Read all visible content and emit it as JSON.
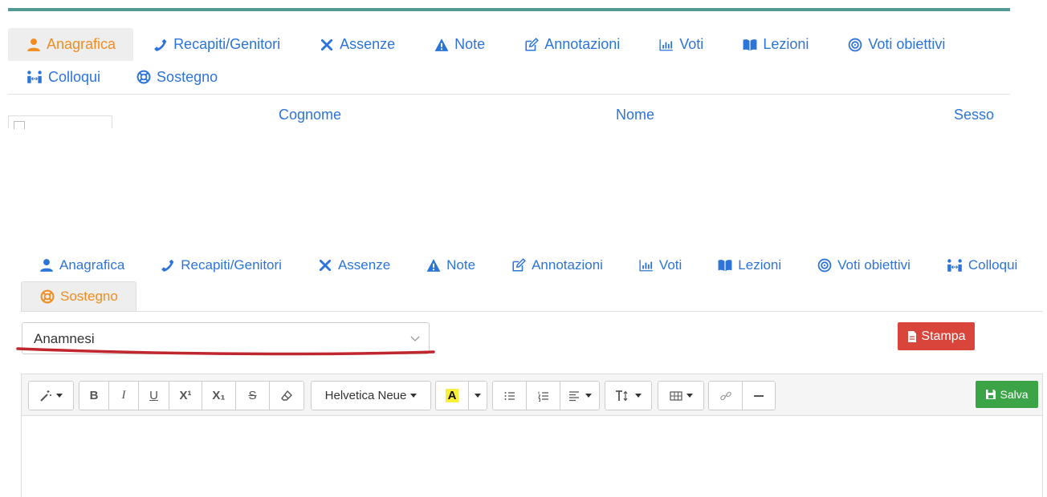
{
  "colors": {
    "accent_blue": "#2d74d8",
    "active_orange": "#f28c1e",
    "teal_bar": "#4f9a94",
    "stampa_red": "#d9453a",
    "salva_green": "#3aa447",
    "annotation_red": "#c0262d"
  },
  "top_tabs": [
    {
      "label": "Anagrafica",
      "icon": "user-icon",
      "active": true
    },
    {
      "label": "Recapiti/Genitori",
      "icon": "phone-icon",
      "active": false
    },
    {
      "label": "Assenze",
      "icon": "times-icon",
      "active": false
    },
    {
      "label": "Note",
      "icon": "warning-icon",
      "active": false
    },
    {
      "label": "Annotazioni",
      "icon": "edit-icon",
      "active": false
    },
    {
      "label": "Voti",
      "icon": "bar-chart-icon",
      "active": false
    },
    {
      "label": "Lezioni",
      "icon": "book-icon",
      "active": false
    },
    {
      "label": "Voti obiettivi",
      "icon": "target-icon",
      "active": false
    },
    {
      "label": "Colloqui",
      "icon": "people-icon",
      "active": false
    },
    {
      "label": "Sostegno",
      "icon": "lifebuoy-icon",
      "active": false
    }
  ],
  "table_header": {
    "cognome": "Cognome",
    "nome": "Nome",
    "sesso": "Sesso"
  },
  "bottom_tabs": [
    {
      "label": "Anagrafica",
      "icon": "user-icon",
      "active": false
    },
    {
      "label": "Recapiti/Genitori",
      "icon": "phone-icon",
      "active": false
    },
    {
      "label": "Assenze",
      "icon": "times-icon",
      "active": false
    },
    {
      "label": "Note",
      "icon": "warning-icon",
      "active": false
    },
    {
      "label": "Annotazioni",
      "icon": "edit-icon",
      "active": false
    },
    {
      "label": "Voti",
      "icon": "bar-chart-icon",
      "active": false
    },
    {
      "label": "Lezioni",
      "icon": "book-icon",
      "active": false
    },
    {
      "label": "Voti obiettivi",
      "icon": "target-icon",
      "active": false
    },
    {
      "label": "Colloqui",
      "icon": "people-icon",
      "active": false
    },
    {
      "label": "Sostegno",
      "icon": "lifebuoy-icon",
      "active": true
    }
  ],
  "document_select": {
    "value": "Anamnesi"
  },
  "stampa_button": {
    "label": "Stampa"
  },
  "editor": {
    "font_name": "Helvetica Neue",
    "font_color_sample": "A",
    "salva_label": "Salva",
    "bold": "B",
    "italic": "I",
    "underline": "U",
    "superscript": "X¹",
    "subscript": "X₁",
    "strike": "S"
  }
}
